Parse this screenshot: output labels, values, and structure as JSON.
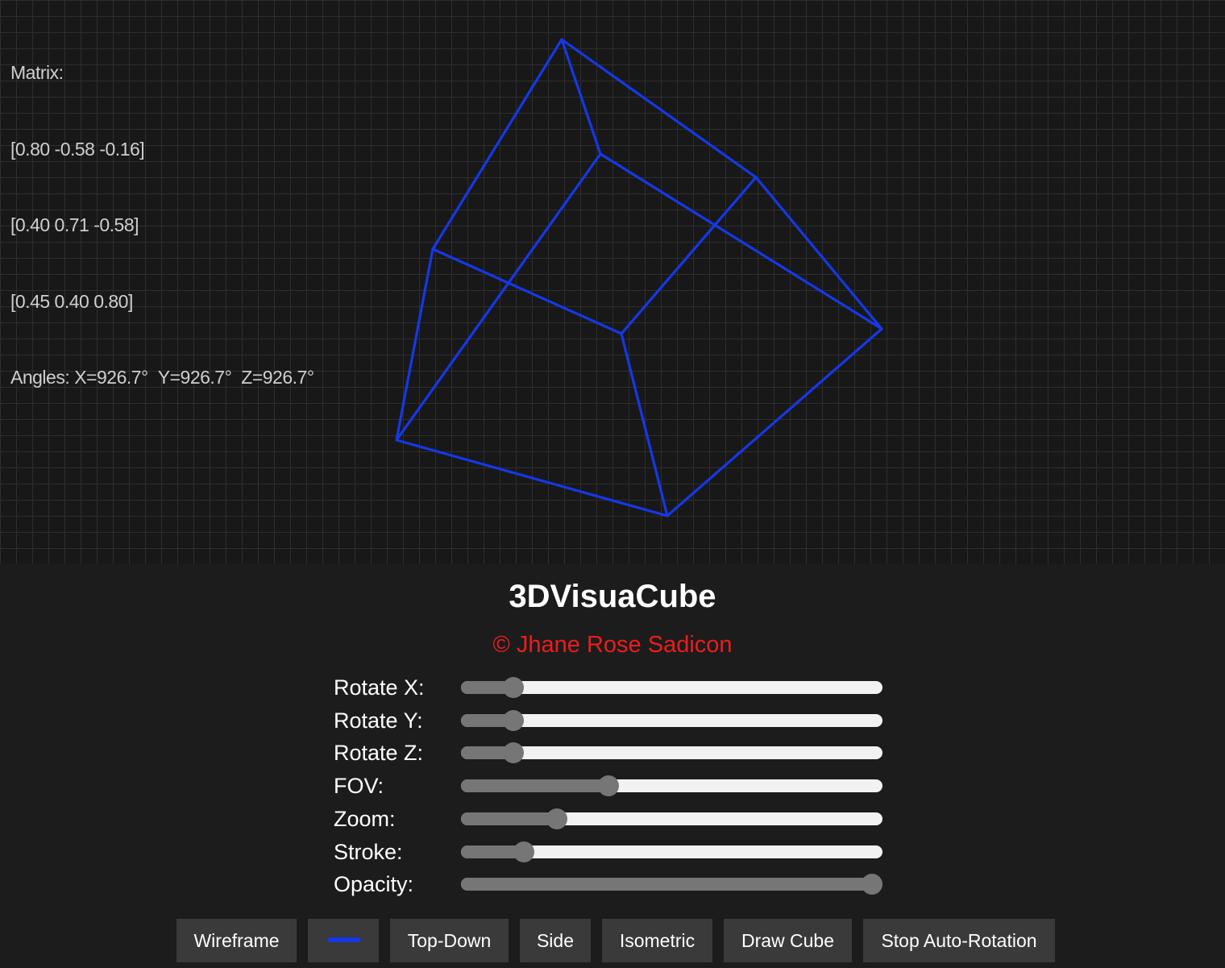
{
  "matrix": {
    "label": "Matrix:",
    "rows": [
      "[0.80 -0.58 -0.16]",
      "[0.40 0.71 -0.58]",
      "[0.45 0.40 0.80]"
    ]
  },
  "angles": {
    "prefix": "Angles:",
    "x": "X=926.7°",
    "y": "Y=926.7°",
    "z": "Z=926.7°"
  },
  "cube": {
    "stroke_color": "#1538e8",
    "grid_color": "#2e2e2e",
    "background_color": "#181818"
  },
  "header": {
    "title": "3DVisuaCube",
    "copyright": "© Jhane Rose Sadicon",
    "copyright_color": "#ee1c1c"
  },
  "controls": [
    {
      "label": "Rotate X:",
      "fraction": 0.104
    },
    {
      "label": "Rotate Y:",
      "fraction": 0.104
    },
    {
      "label": "Rotate Z:",
      "fraction": 0.104
    },
    {
      "label": "FOV:",
      "fraction": 0.342
    },
    {
      "label": "Zoom:",
      "fraction": 0.214
    },
    {
      "label": "Stroke:",
      "fraction": 0.13
    },
    {
      "label": "Opacity:",
      "fraction": 1.0
    }
  ],
  "buttons": {
    "wireframe": "Wireframe",
    "color_icon": "line-color-swatch-icon",
    "top_down": "Top-Down",
    "side": "Side",
    "isometric": "Isometric",
    "draw_cube": "Draw Cube",
    "stop_rotation": "Stop Auto-Rotation"
  }
}
